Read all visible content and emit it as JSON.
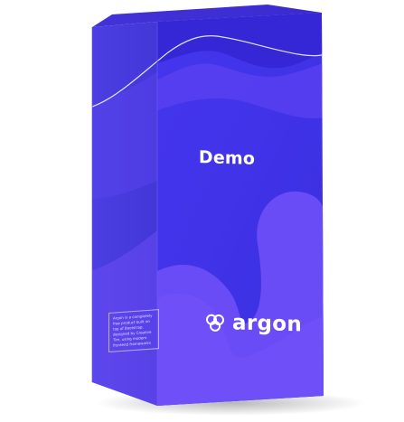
{
  "product_box": {
    "front_title": "Demo",
    "brand_name": "argon",
    "side_note": "Argon is a completely free product built on top of Bootstrap, designed by Creative Tim, using modern frontend frameworks",
    "colors": {
      "front": "#3b33e6",
      "front_light": "#5b46f0",
      "blob": "#6646f3",
      "side": "#4a3ddc",
      "top": "#3d2fd4",
      "background": "#ffffff"
    }
  }
}
